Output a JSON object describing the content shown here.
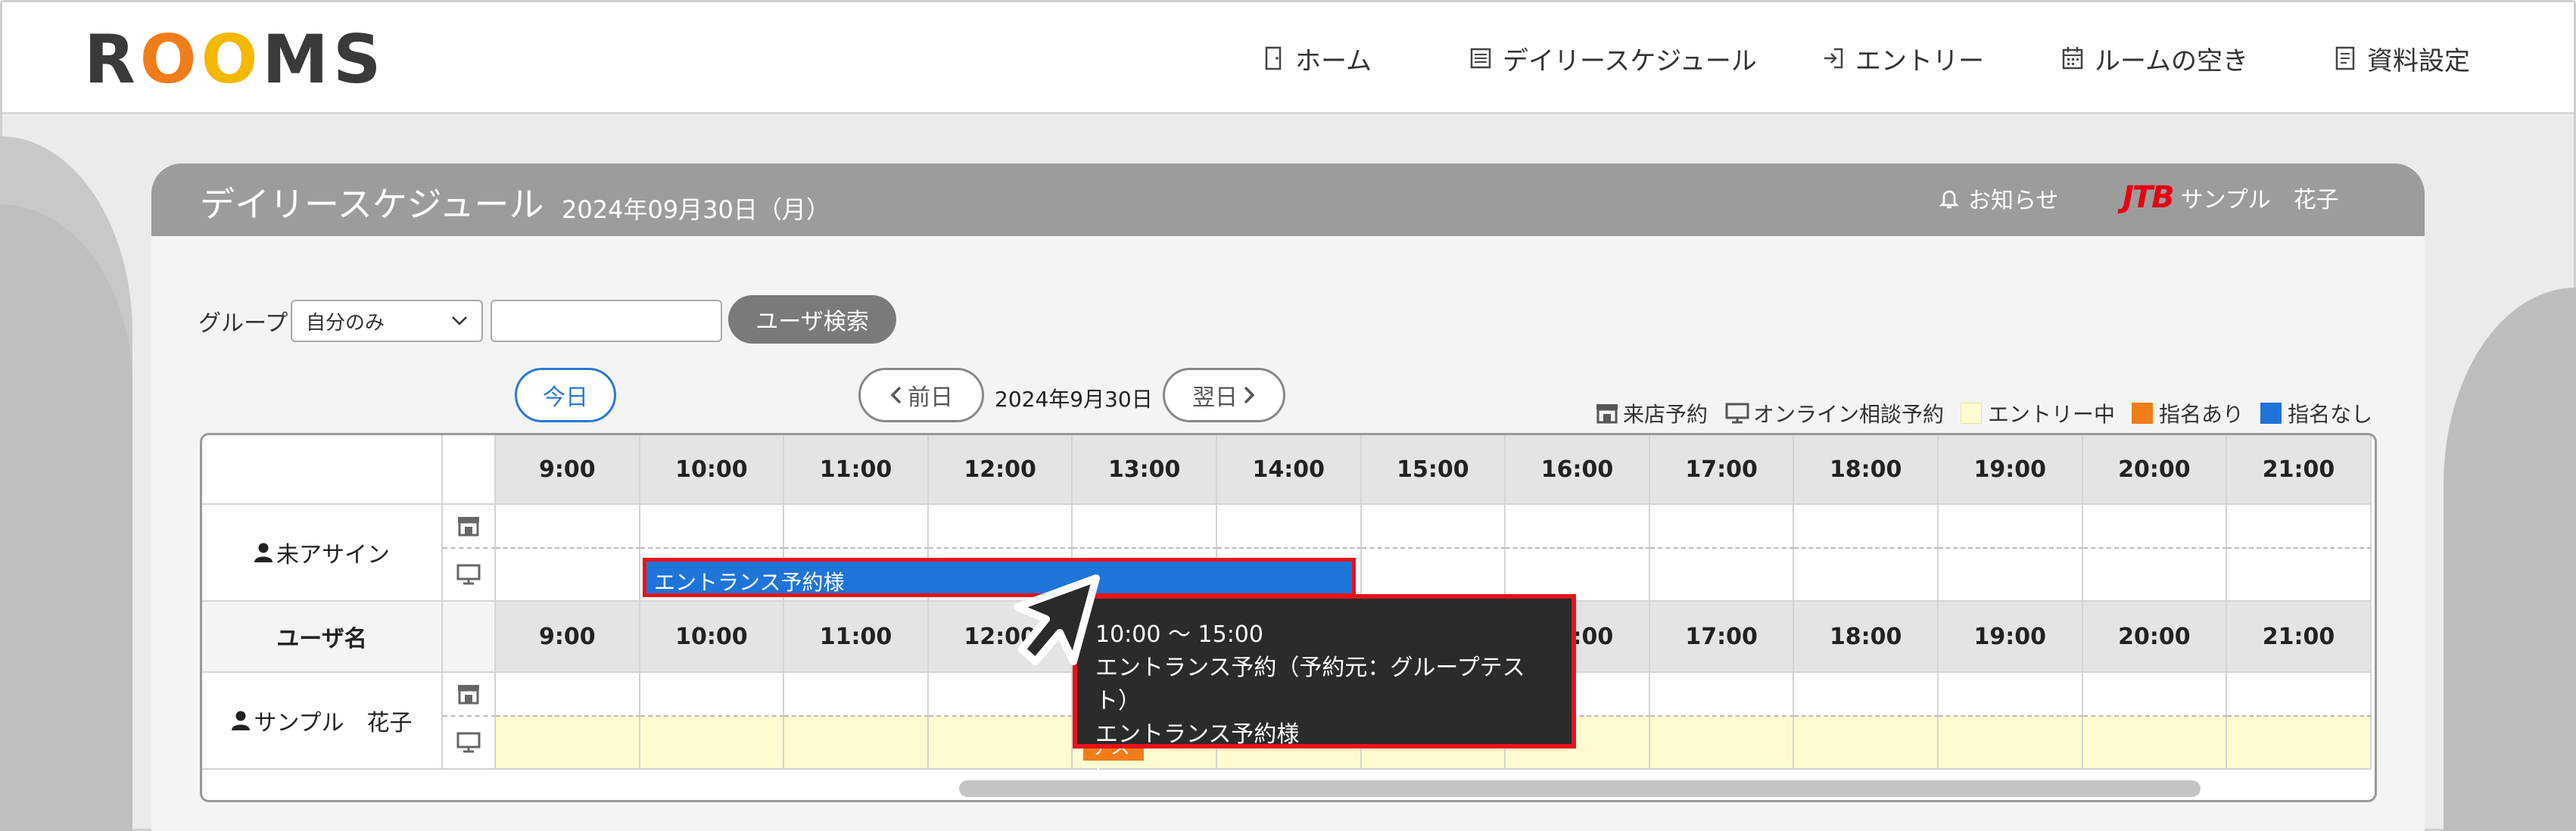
{
  "logo": {
    "letters": [
      "R",
      "O",
      "O",
      "M",
      "S"
    ],
    "colors": [
      "#3a3a3a",
      "#f07d1a",
      "#f5b800",
      "#3a3a3a",
      "#3a3a3a"
    ]
  },
  "nav": [
    {
      "label": "ホーム",
      "icon": "door-icon"
    },
    {
      "label": "デイリースケジュール",
      "icon": "list-icon"
    },
    {
      "label": "エントリー",
      "icon": "login-icon"
    },
    {
      "label": "ルームの空き",
      "icon": "calendar-icon"
    },
    {
      "label": "資料設定",
      "icon": "document-icon"
    }
  ],
  "panel": {
    "title": "デイリースケジュール",
    "date": "2024年09月30日（月）",
    "notice": "お知らせ",
    "company_logo": "JTB",
    "user": "サンプル　花子"
  },
  "filter": {
    "label": "グループ",
    "select_value": "自分のみ",
    "search_value": "",
    "search_button": "ユーザ検索"
  },
  "datenav": {
    "today": "今日",
    "prev": "前日",
    "current": "2024年9月30日",
    "next": "翌日"
  },
  "legend": [
    {
      "label": "来店予約",
      "icon": "store-icon"
    },
    {
      "label": "オンライン相談予約",
      "icon": "monitor-icon"
    },
    {
      "label": "エントリー中",
      "color": "#fffbd0"
    },
    {
      "label": "指名あり",
      "color": "#f07d1a"
    },
    {
      "label": "指名なし",
      "color": "#1e74d8"
    }
  ],
  "hours": [
    "9:00",
    "10:00",
    "11:00",
    "12:00",
    "13:00",
    "14:00",
    "15:00",
    "16:00",
    "17:00",
    "18:00",
    "19:00",
    "20:00",
    "21:00"
  ],
  "rows": {
    "unassigned": "未アサイン",
    "user_header": "ユーザ名",
    "user": "サンプル　花子"
  },
  "booking": {
    "label": "エントランス予約様"
  },
  "orange_tag": {
    "label": "テスト"
  },
  "tooltip": {
    "time": "10:00 〜 15:00",
    "line2": "エントランス予約（予約元：グループテスト）",
    "line3": "エントランス予約様"
  }
}
